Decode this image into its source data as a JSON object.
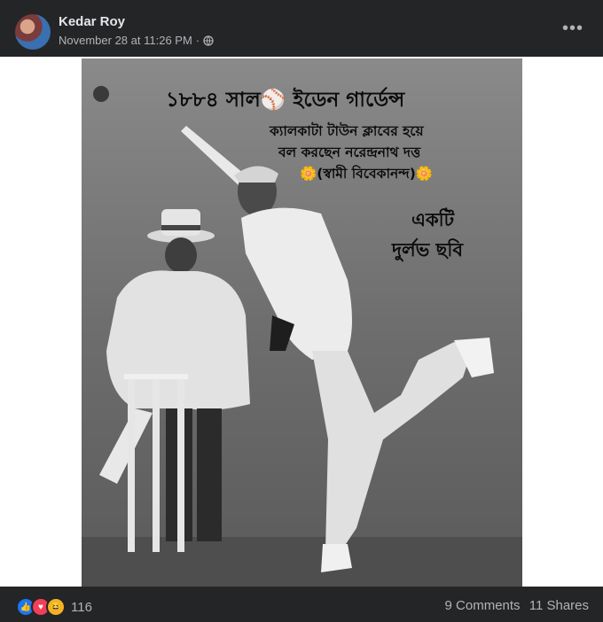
{
  "post": {
    "author": "Kedar Roy",
    "timestamp": "November 28 at 11:26 PM",
    "separator": "·"
  },
  "image": {
    "line1": "১৮৮৪ সাল⚾ ইডেন গার্ডেন্স",
    "line2": "ক্যালকাটা টাউন ক্লাবের হয়ে",
    "line3": "বল করছেন নরেন্দ্রনাথ দত্ত",
    "line4": "🌼(স্বামী বিবেকানন্দ)🌼",
    "line5": "একটি",
    "line6": "দুর্লভ ছবি"
  },
  "footer": {
    "reaction_count": "116",
    "comments": "9 Comments",
    "shares": "11 Shares"
  },
  "icons": [
    "globe-icon",
    "more-options-icon",
    "like-reaction-icon",
    "love-reaction-icon",
    "haha-reaction-icon"
  ],
  "colors": {
    "background": "#242526",
    "text_primary": "#e4e6eb",
    "text_secondary": "#b0b3b8",
    "like_blue": "#1877f2",
    "love_red": "#f33e58",
    "haha_yellow": "#f7b125"
  }
}
